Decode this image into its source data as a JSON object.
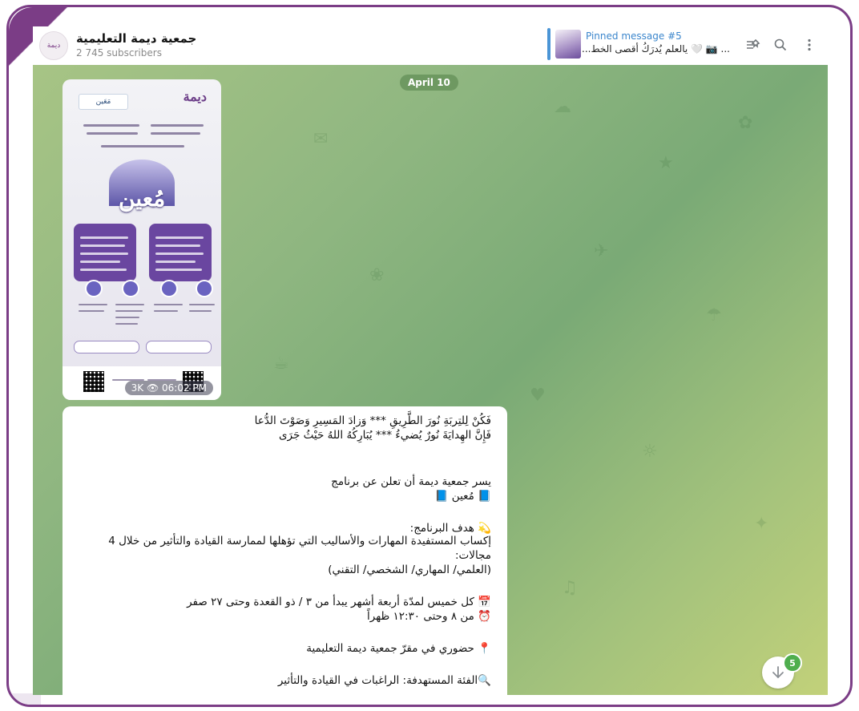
{
  "header": {
    "channel_avatar": "ديمة",
    "channel_name": "جمعية ديمة التعليمية",
    "subscribers": "2 745 subscribers",
    "pinned_title": "Pinned message #5",
    "pinned_text": "... 📷 🤍 يالعلم يُدرَكُ أقصى الخط...",
    "icons": [
      "pinned-list-icon",
      "search-icon",
      "more-icon"
    ]
  },
  "chat": {
    "date_label": "April 10",
    "poster": {
      "brand": "ديمة",
      "partner_logo": "مَعَين",
      "program_word": "مُعين",
      "views": "3K",
      "time": "06:02 PM"
    },
    "message_lines": [
      "فَكُنْ لِلتِربَةِ نُورَ الطَّرِيقِ *** وَزادَ المَسِيرِ وَصَوْتَ الدُّعا",
      "فَإِنَّ الهِدايَةَ نُورٌ يُضيءُ *** يُبَارِكُهُ اللهُ حَيْثُ جَرَى",
      "يسر جمعية ديمة أن تعلن عن برنامج",
      "📘 مُعين 📘",
      "💫 هدف البرنامج:",
      "إكساب المستفيدة المهارات والأساليب التي تؤهلها لممارسة القيادة والتأثير من خلال 4",
      "مجالات:",
      "(العلمي/ المهاري/ الشخصي/ التقني)",
      "📅 كل خميس لمدّة أربعة أشهر يبدأ من ٣ / ذو القعدة وحتى ٢٧ صفر",
      "⏰ من ٨ وحتى ١٢:٣٠ ظهراً",
      "📍 حضوري في مقرّ جمعية ديمة التعليمية",
      "🔍الفئة المستهدفة: الراغبات في القيادة والتأثير"
    ]
  },
  "scroll": {
    "unread_count": "5"
  },
  "colors": {
    "frame": "#7b3d86",
    "pinned_accent": "#3b86cc",
    "badge": "#4fae4e"
  }
}
